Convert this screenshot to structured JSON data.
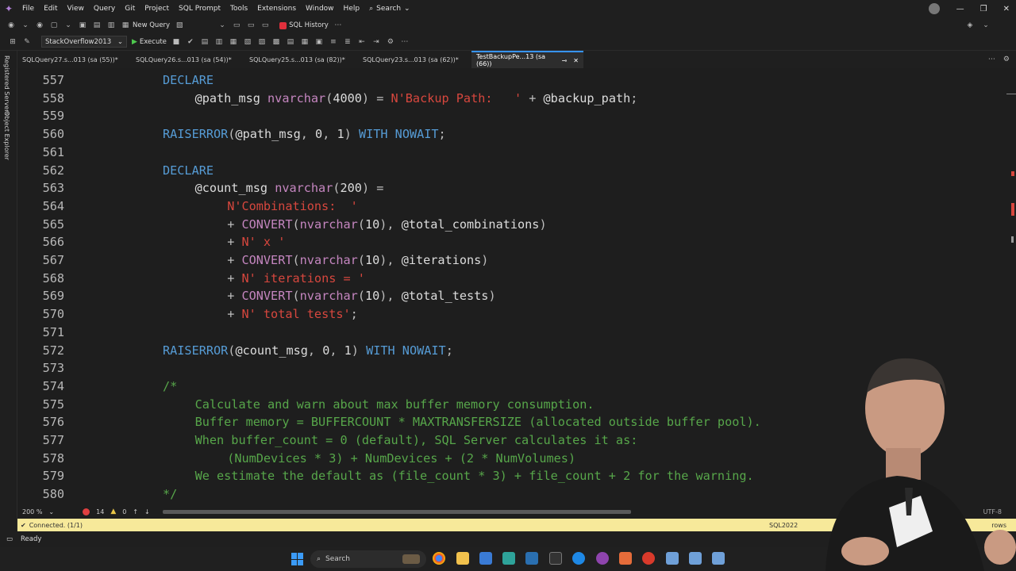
{
  "menu": {
    "items": [
      "File",
      "Edit",
      "View",
      "Query",
      "Git",
      "Project",
      "SQL Prompt",
      "Tools",
      "Extensions",
      "Window",
      "Help"
    ],
    "search_label": "Search"
  },
  "toolbar": {
    "new_query_label": "New Query",
    "sql_history_label": "SQL History"
  },
  "toolbar2": {
    "database": "StackOverflow2013",
    "execute_label": "Execute"
  },
  "side_panels": [
    "Registered Servers",
    "Object Explorer"
  ],
  "tabs": [
    {
      "label": "SQLQuery27.s...013 (sa (55))*",
      "active": false
    },
    {
      "label": "SQLQuery26.s...013 (sa (54))*",
      "active": false
    },
    {
      "label": "SQLQuery25.s...013 (sa (82))*",
      "active": false
    },
    {
      "label": "SQLQuery23.s...013 (sa (62))*",
      "active": false
    },
    {
      "label": "TestBackupPe...13 (sa (66))",
      "active": true
    }
  ],
  "editor": {
    "lines": [
      {
        "num": "557",
        "tokens": [
          [
            "kw",
            "DECLARE"
          ]
        ],
        "indent": 12
      },
      {
        "num": "558",
        "tokens": [
          [
            "var",
            "@path_msg "
          ],
          [
            "ty",
            "nvarchar"
          ],
          [
            "pl",
            "("
          ],
          [
            "num",
            "4000"
          ],
          [
            "pl",
            ") = "
          ],
          [
            "str",
            "N'Backup Path:   '"
          ],
          [
            "pl",
            " + "
          ],
          [
            "var",
            "@backup_path"
          ],
          [
            "pl",
            ";"
          ]
        ],
        "indent": 16
      },
      {
        "num": "559",
        "tokens": [],
        "indent": 0
      },
      {
        "num": "560",
        "tokens": [
          [
            "kw",
            "RAISERROR"
          ],
          [
            "pl",
            "("
          ],
          [
            "var",
            "@path_msg"
          ],
          [
            "pl",
            ", "
          ],
          [
            "num",
            "0"
          ],
          [
            "pl",
            ", "
          ],
          [
            "num",
            "1"
          ],
          [
            "pl",
            ") "
          ],
          [
            "kw",
            "WITH NOWAIT"
          ],
          [
            "pl",
            ";"
          ]
        ],
        "indent": 12
      },
      {
        "num": "561",
        "tokens": [],
        "indent": 0
      },
      {
        "num": "562",
        "tokens": [
          [
            "kw",
            "DECLARE"
          ]
        ],
        "indent": 12
      },
      {
        "num": "563",
        "tokens": [
          [
            "var",
            "@count_msg "
          ],
          [
            "ty",
            "nvarchar"
          ],
          [
            "pl",
            "("
          ],
          [
            "num",
            "200"
          ],
          [
            "pl",
            ") ="
          ]
        ],
        "indent": 16
      },
      {
        "num": "564",
        "tokens": [
          [
            "str",
            "N'Combinations:  '"
          ]
        ],
        "indent": 20
      },
      {
        "num": "565",
        "tokens": [
          [
            "pl",
            "+ "
          ],
          [
            "fn",
            "CONVERT"
          ],
          [
            "pl",
            "("
          ],
          [
            "ty",
            "nvarchar"
          ],
          [
            "pl",
            "("
          ],
          [
            "num",
            "10"
          ],
          [
            "pl",
            "), "
          ],
          [
            "var",
            "@total_combinations"
          ],
          [
            "pl",
            ")"
          ]
        ],
        "indent": 20
      },
      {
        "num": "566",
        "tokens": [
          [
            "pl",
            "+ "
          ],
          [
            "str",
            "N' x '"
          ]
        ],
        "indent": 20
      },
      {
        "num": "567",
        "tokens": [
          [
            "pl",
            "+ "
          ],
          [
            "fn",
            "CONVERT"
          ],
          [
            "pl",
            "("
          ],
          [
            "ty",
            "nvarchar"
          ],
          [
            "pl",
            "("
          ],
          [
            "num",
            "10"
          ],
          [
            "pl",
            "), "
          ],
          [
            "var",
            "@iterations"
          ],
          [
            "pl",
            ")"
          ]
        ],
        "indent": 20
      },
      {
        "num": "568",
        "tokens": [
          [
            "pl",
            "+ "
          ],
          [
            "str",
            "N' iterations = '"
          ]
        ],
        "indent": 20
      },
      {
        "num": "569",
        "tokens": [
          [
            "pl",
            "+ "
          ],
          [
            "fn",
            "CONVERT"
          ],
          [
            "pl",
            "("
          ],
          [
            "ty",
            "nvarchar"
          ],
          [
            "pl",
            "("
          ],
          [
            "num",
            "10"
          ],
          [
            "pl",
            "), "
          ],
          [
            "var",
            "@total_tests"
          ],
          [
            "pl",
            ")"
          ]
        ],
        "indent": 20
      },
      {
        "num": "570",
        "tokens": [
          [
            "pl",
            "+ "
          ],
          [
            "str",
            "N' total tests'"
          ],
          [
            "pl",
            ";"
          ]
        ],
        "indent": 20
      },
      {
        "num": "571",
        "tokens": [],
        "indent": 0
      },
      {
        "num": "572",
        "tokens": [
          [
            "kw",
            "RAISERROR"
          ],
          [
            "pl",
            "("
          ],
          [
            "var",
            "@count_msg"
          ],
          [
            "pl",
            ", "
          ],
          [
            "num",
            "0"
          ],
          [
            "pl",
            ", "
          ],
          [
            "num",
            "1"
          ],
          [
            "pl",
            ") "
          ],
          [
            "kw",
            "WITH NOWAIT"
          ],
          [
            "pl",
            ";"
          ]
        ],
        "indent": 12
      },
      {
        "num": "573",
        "tokens": [],
        "indent": 0
      },
      {
        "num": "574",
        "tokens": [
          [
            "cm",
            "/*"
          ]
        ],
        "indent": 12
      },
      {
        "num": "575",
        "tokens": [
          [
            "cm",
            "Calculate and warn about max buffer memory consumption."
          ]
        ],
        "indent": 16
      },
      {
        "num": "576",
        "tokens": [
          [
            "cm",
            "Buffer memory = BUFFERCOUNT * MAXTRANSFERSIZE (allocated outside buffer pool)."
          ]
        ],
        "indent": 16
      },
      {
        "num": "577",
        "tokens": [
          [
            "cm",
            "When buffer_count = 0 (default), SQL Server calculates it as:"
          ]
        ],
        "indent": 16
      },
      {
        "num": "578",
        "tokens": [
          [
            "cm",
            "(NumDevices * 3) + NumDevices + (2 * NumVolumes)"
          ]
        ],
        "indent": 20
      },
      {
        "num": "579",
        "tokens": [
          [
            "cm",
            "We estimate the default as (file_count * 3) + file_count + 2 for the warning."
          ]
        ],
        "indent": 16
      },
      {
        "num": "580",
        "tokens": [
          [
            "cm",
            "*/"
          ]
        ],
        "indent": 12
      }
    ]
  },
  "editor_status": {
    "zoom": "200 %",
    "errors": "14",
    "warnings": "0",
    "encoding": "UTF-8"
  },
  "status": {
    "connection": "Connected. (1/1)",
    "server": "SQL2022",
    "rows": "rows"
  },
  "ready_label": "Ready",
  "taskbar": {
    "search_placeholder": "Search"
  },
  "colors": {
    "keyword": "#569cd6",
    "type": "#c586c0",
    "string": "#d7473e",
    "comment": "#57a64a",
    "status_bar": "#f7e99a"
  }
}
